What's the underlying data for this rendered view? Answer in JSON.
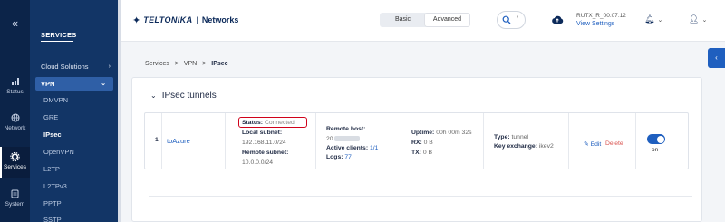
{
  "rail": {
    "collapse": "«",
    "items": [
      {
        "label": "Status"
      },
      {
        "label": "Network"
      },
      {
        "label": "Services"
      },
      {
        "label": "System"
      }
    ]
  },
  "menu": {
    "title": "SERVICES",
    "cloud": "Cloud Solutions",
    "vpn": "VPN",
    "sub": [
      "DMVPN",
      "GRE",
      "IPsec",
      "OpenVPN",
      "L2TP",
      "L2TPv3",
      "PPTP",
      "SSTP"
    ]
  },
  "top": {
    "brand": "TELTONIKA",
    "sep": "|",
    "network": "Networks",
    "mode_basic": "Basic",
    "mode_advanced": "Advanced",
    "search_hint": "/",
    "device": "RUTX_R_00.07.12",
    "view_settings": "View Settings"
  },
  "breadcrumb": {
    "a": "Services",
    "b": "VPN",
    "c": "IPsec",
    "sep": ">"
  },
  "card": {
    "title": "IPsec tunnels",
    "row": {
      "index": "1",
      "name": "toAzure",
      "status_label": "Status:",
      "status_value": "Connected",
      "local_label": "Local subnet:",
      "local_value": "192.168.11.0/24",
      "remote_subnet_label": "Remote subnet:",
      "remote_subnet_value": "10.0.0.0/24",
      "remote_host_label": "Remote host:",
      "remote_host_prefix": "20.",
      "clients_label": "Active clients:",
      "clients_value": "1/1",
      "logs_label": "Logs:",
      "logs_value": "77",
      "uptime_label": "Uptime:",
      "uptime_value": "00h 00m 32s",
      "rx_label": "RX:",
      "rx_value": "0 B",
      "tx_label": "TX:",
      "tx_value": "0 B",
      "type_label": "Type:",
      "type_value": "tunnel",
      "kex_label": "Key exchange:",
      "kex_value": "ikev2",
      "edit": "Edit",
      "delete": "Delete",
      "toggle": "on"
    }
  },
  "colors": {
    "accent": "#1f5fbf",
    "sidebar": "#123566",
    "rail": "#0c2449",
    "status_box": "#d0021b"
  }
}
